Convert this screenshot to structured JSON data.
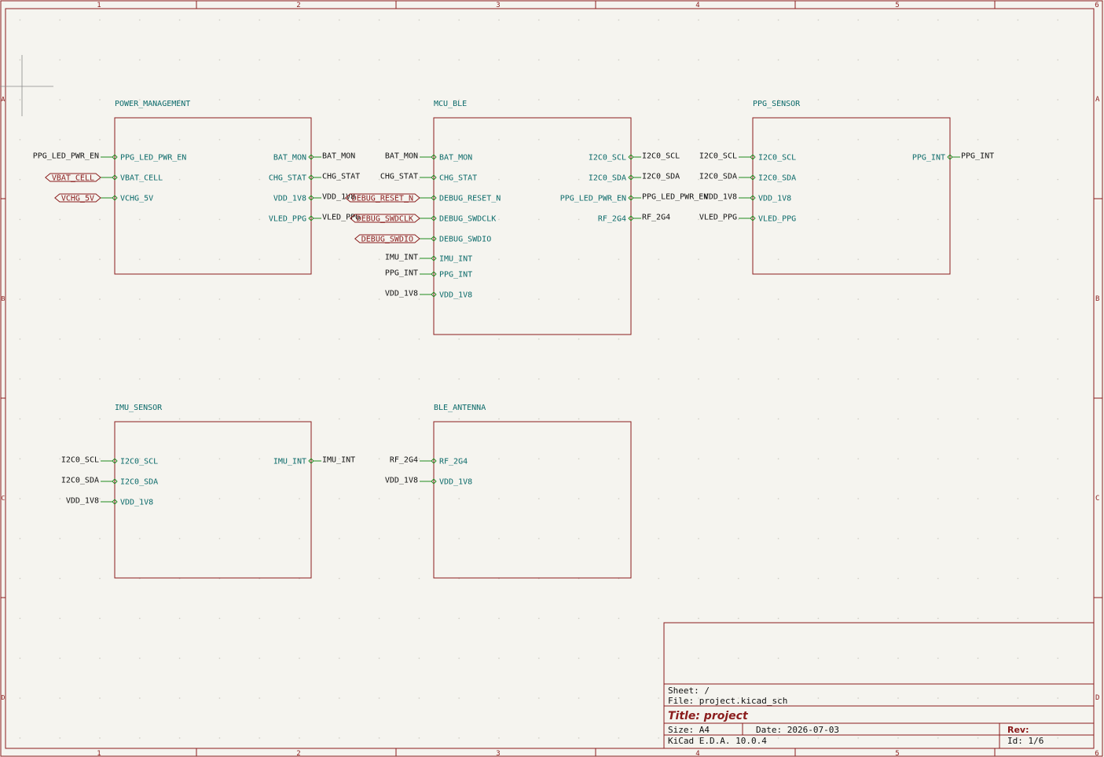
{
  "colors": {
    "background": "#f5f4ef",
    "frame": "#8a1c1c",
    "sheet_border": "#8a1c1c",
    "pin_text": "#0b6a6a",
    "label_text": "#111111",
    "wire": "#1e8a1e",
    "hier_label": "#8a1c1c",
    "grid_dot": "#c8c6bd"
  },
  "frame": {
    "columns": [
      "1",
      "2",
      "3",
      "4",
      "5",
      "6"
    ],
    "rows": [
      "A",
      "B",
      "C",
      "D"
    ]
  },
  "sheets": [
    {
      "name": "POWER_MANAGEMENT",
      "left_pins": [
        "PPG_LED_PWR_EN",
        "VBAT_CELL",
        "VCHG_5V"
      ],
      "right_pins": [
        "BAT_MON",
        "CHG_STAT",
        "VDD_1V8",
        "VLED_PPG"
      ],
      "left_labels": [
        {
          "text": "PPG_LED_PWR_EN",
          "kind": "net"
        },
        {
          "text": "VBAT_CELL",
          "kind": "hier"
        },
        {
          "text": "VCHG_5V",
          "kind": "hier"
        }
      ],
      "right_labels": [
        "BAT_MON",
        "CHG_STAT",
        "VDD_1V8",
        "VLED_PPG"
      ]
    },
    {
      "name": "MCU_BLE",
      "left_pins": [
        "BAT_MON",
        "CHG_STAT",
        "DEBUG_RESET_N",
        "DEBUG_SWDCLK",
        "DEBUG_SWDIO",
        "IMU_INT",
        "PPG_INT",
        "VDD_1V8"
      ],
      "right_pins": [
        "I2C0_SCL",
        "I2C0_SDA",
        "PPG_LED_PWR_EN",
        "RF_2G4"
      ],
      "left_labels": [
        {
          "text": "BAT_MON",
          "kind": "net"
        },
        {
          "text": "CHG_STAT",
          "kind": "net"
        },
        {
          "text": "DEBUG_RESET_N",
          "kind": "hier"
        },
        {
          "text": "DEBUG_SWDCLK",
          "kind": "hier"
        },
        {
          "text": "DEBUG_SWDIO",
          "kind": "hier"
        },
        {
          "text": "IMU_INT",
          "kind": "net"
        },
        {
          "text": "PPG_INT",
          "kind": "net"
        },
        {
          "text": "VDD_1V8",
          "kind": "net"
        }
      ],
      "right_labels": [
        "I2C0_SCL",
        "I2C0_SDA",
        "PPG_LED_PWR_EN",
        "RF_2G4"
      ]
    },
    {
      "name": "PPG_SENSOR",
      "left_pins": [
        "I2C0_SCL",
        "I2C0_SDA",
        "VDD_1V8",
        "VLED_PPG"
      ],
      "right_pins": [
        "PPG_INT"
      ],
      "left_labels": [
        {
          "text": "I2C0_SCL",
          "kind": "net"
        },
        {
          "text": "I2C0_SDA",
          "kind": "net"
        },
        {
          "text": "VDD_1V8",
          "kind": "net"
        },
        {
          "text": "VLED_PPG",
          "kind": "net"
        }
      ],
      "right_labels": [
        "PPG_INT"
      ]
    },
    {
      "name": "IMU_SENSOR",
      "left_pins": [
        "I2C0_SCL",
        "I2C0_SDA",
        "VDD_1V8"
      ],
      "right_pins": [
        "IMU_INT"
      ],
      "left_labels": [
        {
          "text": "I2C0_SCL",
          "kind": "net"
        },
        {
          "text": "I2C0_SDA",
          "kind": "net"
        },
        {
          "text": "VDD_1V8",
          "kind": "net"
        }
      ],
      "right_labels": [
        "IMU_INT"
      ]
    },
    {
      "name": "BLE_ANTENNA",
      "left_pins": [
        "RF_2G4",
        "VDD_1V8"
      ],
      "right_pins": [],
      "left_labels": [
        {
          "text": "RF_2G4",
          "kind": "net"
        },
        {
          "text": "VDD_1V8",
          "kind": "net"
        }
      ],
      "right_labels": []
    }
  ],
  "title_block": {
    "sheet": "Sheet: /",
    "file": "File: project.kicad_sch",
    "title": "Title: project",
    "size": "Size: A4",
    "date": "Date: 2026-07-03",
    "rev": "Rev:",
    "tool": "KiCad E.D.A. 10.0.4",
    "id": "Id: 1/6"
  }
}
